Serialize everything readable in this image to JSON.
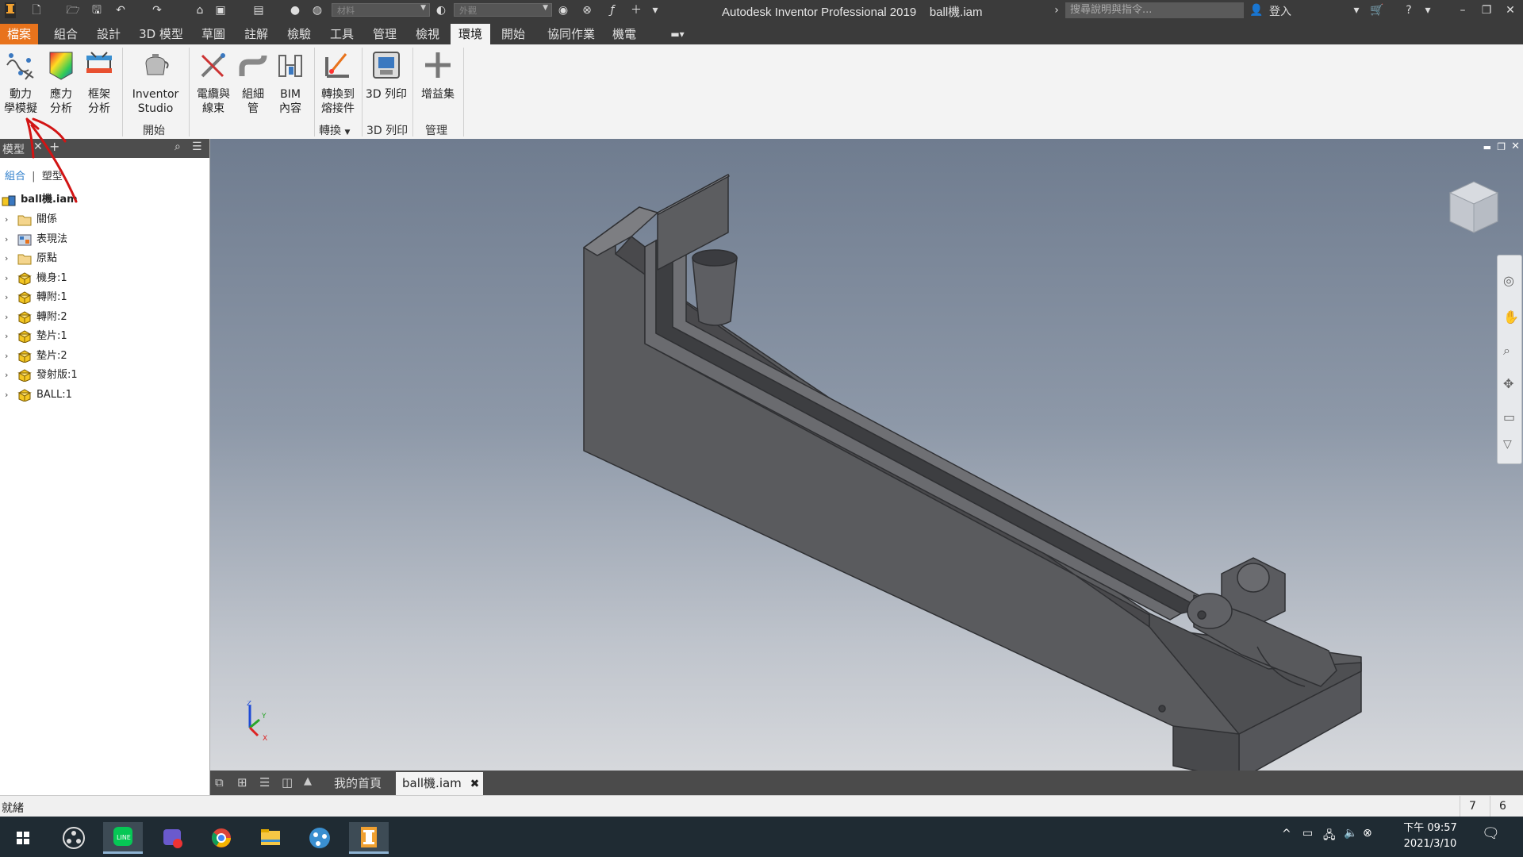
{
  "window": {
    "title": "Autodesk Inventor Professional 2019",
    "document": "ball機.iam",
    "search_placeholder": "搜尋說明與指令...",
    "signin": "登入",
    "qat_material": "材料",
    "qat_appearance": "外觀"
  },
  "ribbon_tabs": [
    "檔案",
    "組合",
    "設計",
    "3D 模型",
    "草圖",
    "註解",
    "檢驗",
    "工具",
    "管理",
    "檢視",
    "環境",
    "開始",
    "協同作業",
    "機電"
  ],
  "active_tab": "環境",
  "ribbon": {
    "buttons": [
      {
        "line1": "動力",
        "line2": "學模擬",
        "icon": "dynamic-simulation-icon"
      },
      {
        "line1": "應力",
        "line2": "分析",
        "icon": "stress-analysis-icon"
      },
      {
        "line1": "框架",
        "line2": "分析",
        "icon": "frame-analysis-icon"
      },
      {
        "line1": "Inventor",
        "line2": "Studio",
        "icon": "inventor-studio-icon"
      },
      {
        "line1": "電纜與",
        "line2": "線束",
        "icon": "cable-harness-icon"
      },
      {
        "line1": "組細",
        "line2": "管",
        "icon": "tube-pipe-icon"
      },
      {
        "line1": "BIM",
        "line2": "內容",
        "icon": "bim-content-icon"
      },
      {
        "line1": "轉換到",
        "line2": "熔接件",
        "icon": "convert-weldment-icon"
      },
      {
        "line1": "3D 列印",
        "line2": "",
        "icon": "3d-print-icon"
      },
      {
        "line1": "增益集",
        "line2": "",
        "icon": "add-ins-icon"
      }
    ],
    "groups": {
      "start": "開始",
      "convert": "轉換",
      "print": "3D 列印",
      "manage": "管理"
    }
  },
  "browser": {
    "title": "模型",
    "tab_assembly": "組合",
    "tab_modeling": "塑型",
    "root": "ball機.iam",
    "items": [
      {
        "label": "關係",
        "type": "folder"
      },
      {
        "label": "表現法",
        "type": "representation"
      },
      {
        "label": "原點",
        "type": "folder"
      },
      {
        "label": "機身:1",
        "type": "part"
      },
      {
        "label": "轉附:1",
        "type": "part"
      },
      {
        "label": "轉附:2",
        "type": "part"
      },
      {
        "label": "墊片:1",
        "type": "part"
      },
      {
        "label": "墊片:2",
        "type": "part"
      },
      {
        "label": "發射版:1",
        "type": "part"
      },
      {
        "label": "BALL:1",
        "type": "part"
      }
    ]
  },
  "doc_tabs": {
    "home": "我的首頁",
    "active": "ball機.iam"
  },
  "status": {
    "text": "就緒",
    "count1": "7",
    "count2": "6"
  },
  "clock": {
    "time": "下午 09:57",
    "date": "2021/3/10"
  },
  "colors": {
    "accent": "#e8731c",
    "titlebar": "#3b3b3b",
    "annotation": "#d21414"
  }
}
